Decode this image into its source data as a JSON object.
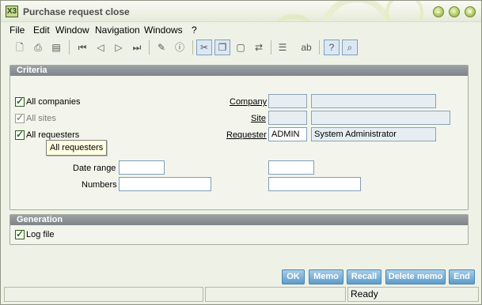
{
  "window": {
    "title": "Purchase request close",
    "app_icon": "X3"
  },
  "window_buttons": {
    "minimize": "–",
    "restore": "▫",
    "close": "×"
  },
  "menu": [
    "File",
    "Edit",
    "Window",
    "Navigation",
    "Windows",
    "?"
  ],
  "toolbar": [
    "new-document-icon",
    "print-icon",
    "print-preview-icon",
    "first-record-icon",
    "previous-record-icon",
    "next-record-icon",
    "last-record-icon",
    "attachment-icon",
    "info-icon",
    "selection-icon",
    "copy-icon",
    "paste-icon",
    "transfer-icon",
    "list-icon",
    "text-field-icon",
    "help-icon",
    "search-icon"
  ],
  "criteria": {
    "header": "Criteria",
    "all_companies": "All companies",
    "all_sites": "All sites",
    "all_requesters": "All requesters",
    "company_label": "Company",
    "company_code": "",
    "company_name": "",
    "site_label": "Site",
    "site_code": "",
    "site_name": "",
    "requester_label": "Requester",
    "requester_code": "ADMIN",
    "requester_name": "System Administrator",
    "date_range_label": "Date range",
    "date_from": "",
    "date_to": "",
    "numbers_label": "Numbers",
    "number_from": "",
    "number_to": ""
  },
  "tooltip": "All requesters",
  "generation": {
    "header": "Generation",
    "log_file": "Log file"
  },
  "actions": {
    "ok": "OK",
    "memo": "Memo",
    "recall": "Recall",
    "delete_memo": "Delete memo",
    "end": "End"
  },
  "status": {
    "text": "Ready"
  },
  "colors": {
    "panel_header": "#8a9195",
    "action_button": "#5d9ccb",
    "check": "#1f7a12",
    "title_bar": "#f5f7ee"
  }
}
